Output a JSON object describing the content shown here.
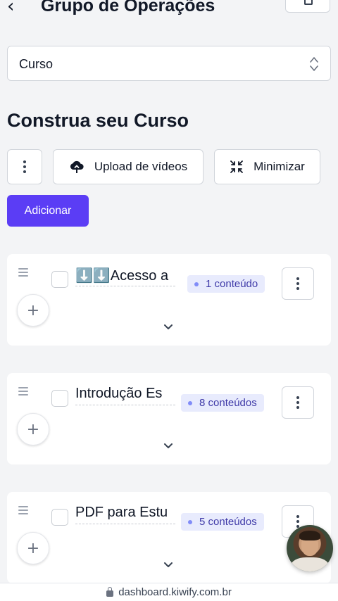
{
  "header": {
    "title": "Grupo de Operações",
    "back_icon": "chevron-left-icon",
    "action_icon": "save-icon"
  },
  "course_select": {
    "value": "Curso",
    "icon": "chevron-up-down-icon"
  },
  "section": {
    "title": "Construa seu Curso"
  },
  "toolbar": {
    "more_icon": "vertical-dots-icon",
    "upload_label": "Upload de vídeos",
    "upload_icon": "cloud-upload-icon",
    "minimize_label": "Minimizar",
    "minimize_icon": "collapse-icon"
  },
  "add_button": {
    "label": "Adicionar",
    "color": "#5b3df5"
  },
  "modules": [
    {
      "title": "⬇️⬇️Acesso a",
      "badge": "1 conteúdo"
    },
    {
      "title": "Introdução Es",
      "badge": "8 conteúdos"
    },
    {
      "title": "PDF para Estu",
      "badge": "5 conteúdos"
    }
  ],
  "browser": {
    "url": "dashboard.kiwify.com.br"
  },
  "colors": {
    "accent": "#5b3df5",
    "badge_bg": "#e8ebfd",
    "badge_text": "#3f3aa8"
  }
}
